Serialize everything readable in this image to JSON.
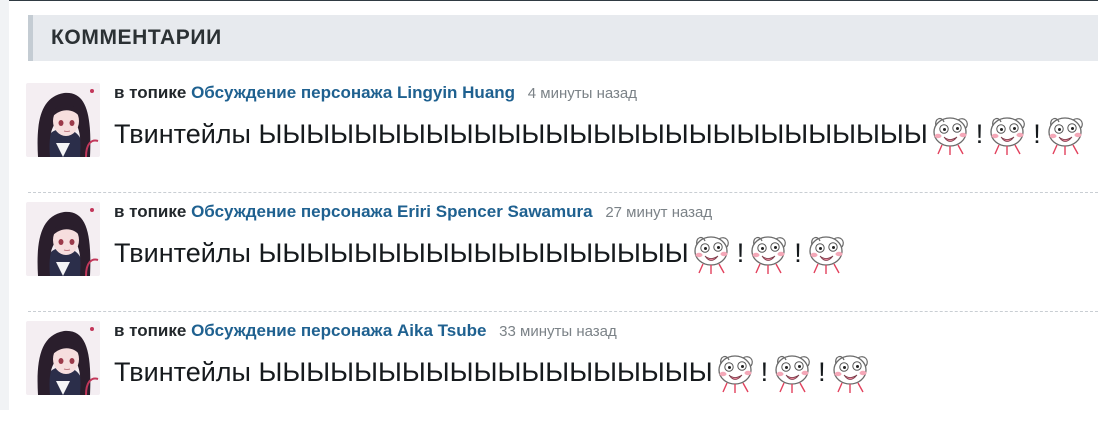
{
  "section": {
    "title": "КОММЕНТАРИИ"
  },
  "comments": [
    {
      "prefix": "в топике",
      "topic": "Обсуждение персонажа Lingyin Huang",
      "time": "4 минуты назад",
      "text": "Твинтейлы ЫЫЫЫЫЫЫЫЫЫЫЫЫЫЫЫЫЫЫЫЫЫЫЫЫЫЫЫ",
      "sep1": "!",
      "sep2": "!"
    },
    {
      "prefix": "в топике",
      "topic": "Обсуждение персонажа Eriri Spencer Sawamura",
      "time": "27 минут назад",
      "text": "Твинтейлы ЫЫЫЫЫЫЫЫЫЫЫЫЫЫЫЫЫЫ",
      "sep1": "!",
      "sep2": "!"
    },
    {
      "prefix": "в топике",
      "topic": "Обсуждение персонажа Aika Tsube",
      "time": "33 минуты назад",
      "text": "Твинтейлы ЫЫЫЫЫЫЫЫЫЫЫЫЫЫЫЫЫЫЫ",
      "sep1": "!",
      "sep2": "!"
    }
  ],
  "icons": {
    "avatar": "anime-girl-avatar",
    "emoticon": "rage-face-smiley"
  },
  "colors": {
    "link": "#1f6190",
    "time": "#7b8287",
    "header_bg": "#e7eaee"
  }
}
